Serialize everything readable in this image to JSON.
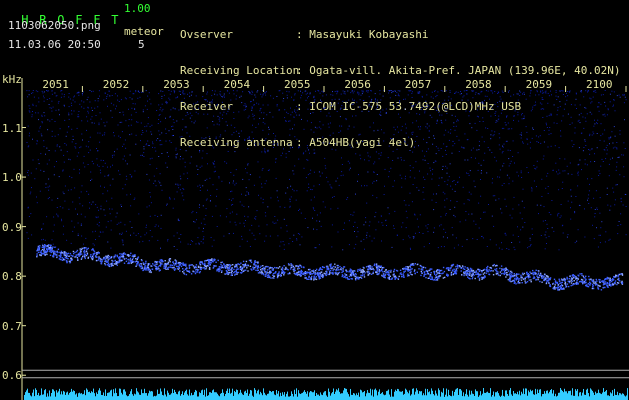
{
  "app": {
    "title_letters": [
      "H",
      "R",
      "O",
      "F",
      "F",
      "T"
    ],
    "version": "1.00",
    "filename": "1103062050.png",
    "timestamp": "11.03.06 20:50",
    "meteor_label": "meteor",
    "meteor_count": "5"
  },
  "info": {
    "rows": [
      {
        "key": "Ovserver",
        "value": ": Masayuki Kobayashi"
      },
      {
        "key": "Receiving Location",
        "value": ": Ogata-vill. Akita-Pref. JAPAN (139.96E, 40.02N)"
      },
      {
        "key": "Receiver",
        "value": ": ICOM IC-575 53.7492(@LCD)MHz USB"
      },
      {
        "key": "Receiving antenna",
        "value": ": A504HB(yagi 4el)"
      }
    ]
  },
  "colors": {
    "background": "#000000",
    "signal": "#3a5cff",
    "noise": "#0a1aa0",
    "bars": "#33ccff",
    "text_yellow": "#e6e6a0",
    "text_green": "#33ff33",
    "ref_lines": "#b0b0b0"
  },
  "chart_data": {
    "type": "scatter",
    "title": "",
    "xlabel": "",
    "ylabel": "kHz",
    "x_tick_labels": [
      "2051",
      "2052",
      "2053",
      "2054",
      "2055",
      "2056",
      "2057",
      "2058",
      "2059",
      "2100"
    ],
    "y_tick_labels": [
      "1.1",
      "1.0",
      "0.9",
      "0.8",
      "0.7",
      "0.6"
    ],
    "ylim": [
      0.55,
      1.2
    ],
    "series": [
      {
        "x": [
          "2051",
          "2052",
          "2053",
          "2054",
          "2055",
          "2056",
          "2057",
          "2058",
          "2059",
          "2100"
        ],
        "values": [
          0.85,
          0.84,
          0.82,
          0.82,
          0.81,
          0.81,
          0.81,
          0.81,
          0.79,
          0.79
        ]
      }
    ],
    "reference_lines": [
      0.61,
      0.595
    ]
  }
}
